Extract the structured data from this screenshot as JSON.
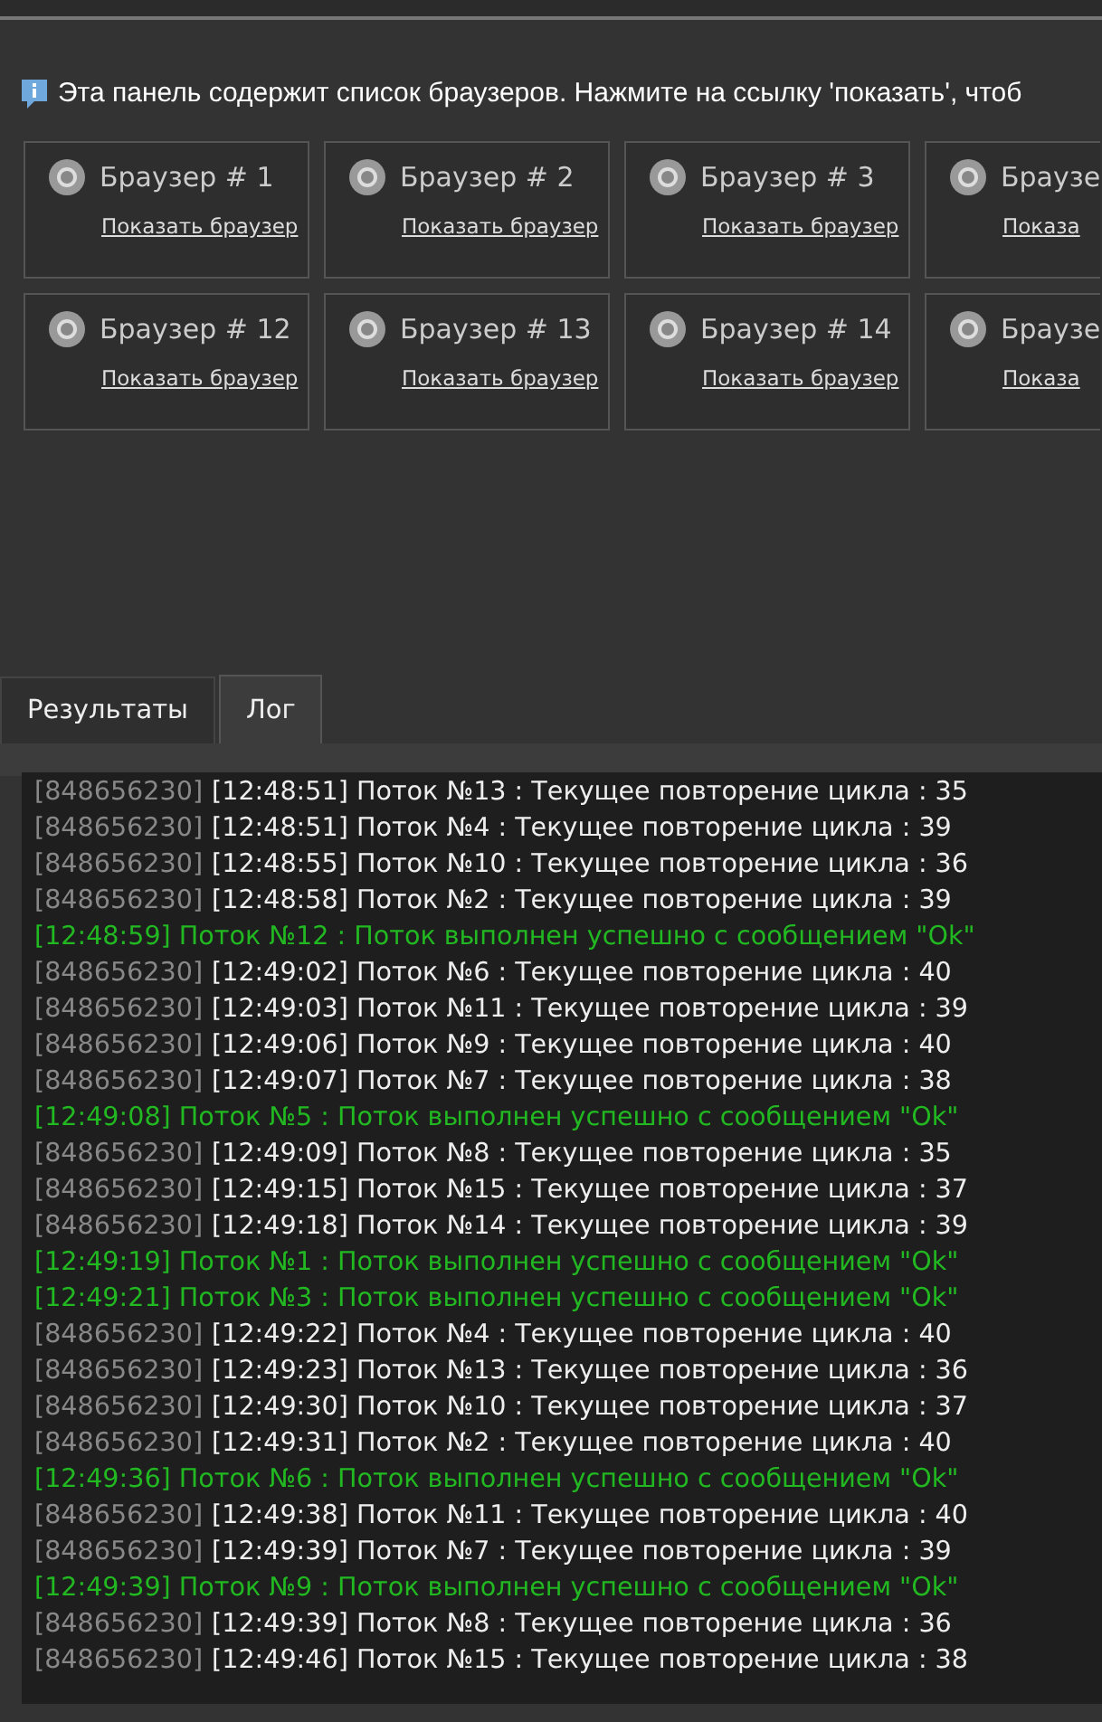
{
  "info": {
    "text": "Эта панель содержит список браузеров. Нажмите на ссылку 'показать', чтоб"
  },
  "browsers": [
    {
      "title": "Браузер # 1",
      "link": "Показать браузер"
    },
    {
      "title": "Браузер # 2",
      "link": "Показать браузер"
    },
    {
      "title": "Браузер # 3",
      "link": "Показать браузер"
    },
    {
      "title": "Браузе",
      "link": "Показа"
    },
    {
      "title": "Браузер # 12",
      "link": "Показать браузер"
    },
    {
      "title": "Браузер # 13",
      "link": "Показать браузер"
    },
    {
      "title": "Браузер # 14",
      "link": "Показать браузер"
    },
    {
      "title": "Браузе",
      "link": "Показа"
    }
  ],
  "tabs": [
    {
      "label": "Результаты",
      "selected": false
    },
    {
      "label": "Лог",
      "selected": true
    }
  ],
  "log": [
    {
      "kind": "status",
      "id": "[848656230]",
      "text": "[12:48:51] Поток №13 : Текущее повторение цикла : 35"
    },
    {
      "kind": "status",
      "id": "[848656230]",
      "text": "[12:48:51] Поток №4 : Текущее повторение цикла : 39"
    },
    {
      "kind": "status",
      "id": "[848656230]",
      "text": "[12:48:55] Поток №10 : Текущее повторение цикла : 36"
    },
    {
      "kind": "status",
      "id": "[848656230]",
      "text": "[12:48:58] Поток №2 : Текущее повторение цикла : 39"
    },
    {
      "kind": "success",
      "text": "[12:48:59] Поток №12 : Поток выполнен успешно с сообщением \"Ok\""
    },
    {
      "kind": "status",
      "id": "[848656230]",
      "text": "[12:49:02] Поток №6 : Текущее повторение цикла : 40"
    },
    {
      "kind": "status",
      "id": "[848656230]",
      "text": "[12:49:03] Поток №11 : Текущее повторение цикла : 39"
    },
    {
      "kind": "status",
      "id": "[848656230]",
      "text": "[12:49:06] Поток №9 : Текущее повторение цикла : 40"
    },
    {
      "kind": "status",
      "id": "[848656230]",
      "text": "[12:49:07] Поток №7 : Текущее повторение цикла : 38"
    },
    {
      "kind": "success",
      "text": "[12:49:08] Поток №5 : Поток выполнен успешно с сообщением \"Ok\""
    },
    {
      "kind": "status",
      "id": "[848656230]",
      "text": "[12:49:09] Поток №8 : Текущее повторение цикла : 35"
    },
    {
      "kind": "status",
      "id": "[848656230]",
      "text": "[12:49:15] Поток №15 : Текущее повторение цикла : 37"
    },
    {
      "kind": "status",
      "id": "[848656230]",
      "text": "[12:49:18] Поток №14 : Текущее повторение цикла : 39"
    },
    {
      "kind": "success",
      "text": "[12:49:19] Поток №1 : Поток выполнен успешно с сообщением \"Ok\""
    },
    {
      "kind": "success",
      "text": "[12:49:21] Поток №3 : Поток выполнен успешно с сообщением \"Ok\""
    },
    {
      "kind": "status",
      "id": "[848656230]",
      "text": "[12:49:22] Поток №4 : Текущее повторение цикла : 40"
    },
    {
      "kind": "status",
      "id": "[848656230]",
      "text": "[12:49:23] Поток №13 : Текущее повторение цикла : 36"
    },
    {
      "kind": "status",
      "id": "[848656230]",
      "text": "[12:49:30] Поток №10 : Текущее повторение цикла : 37"
    },
    {
      "kind": "status",
      "id": "[848656230]",
      "text": "[12:49:31] Поток №2 : Текущее повторение цикла : 40"
    },
    {
      "kind": "success",
      "text": "[12:49:36] Поток №6 : Поток выполнен успешно с сообщением \"Ok\""
    },
    {
      "kind": "status",
      "id": "[848656230]",
      "text": "[12:49:38] Поток №11 : Текущее повторение цикла : 40"
    },
    {
      "kind": "status",
      "id": "[848656230]",
      "text": "[12:49:39] Поток №7 : Текущее повторение цикла : 39"
    },
    {
      "kind": "success",
      "text": "[12:49:39] Поток №9 : Поток выполнен успешно с сообщением \"Ok\""
    },
    {
      "kind": "status",
      "id": "[848656230]",
      "text": "[12:49:39] Поток №8 : Текущее повторение цикла : 36"
    },
    {
      "kind": "status",
      "id": "[848656230]",
      "text": "[12:49:46] Поток №15 : Текущее повторение цикла : 38"
    }
  ]
}
